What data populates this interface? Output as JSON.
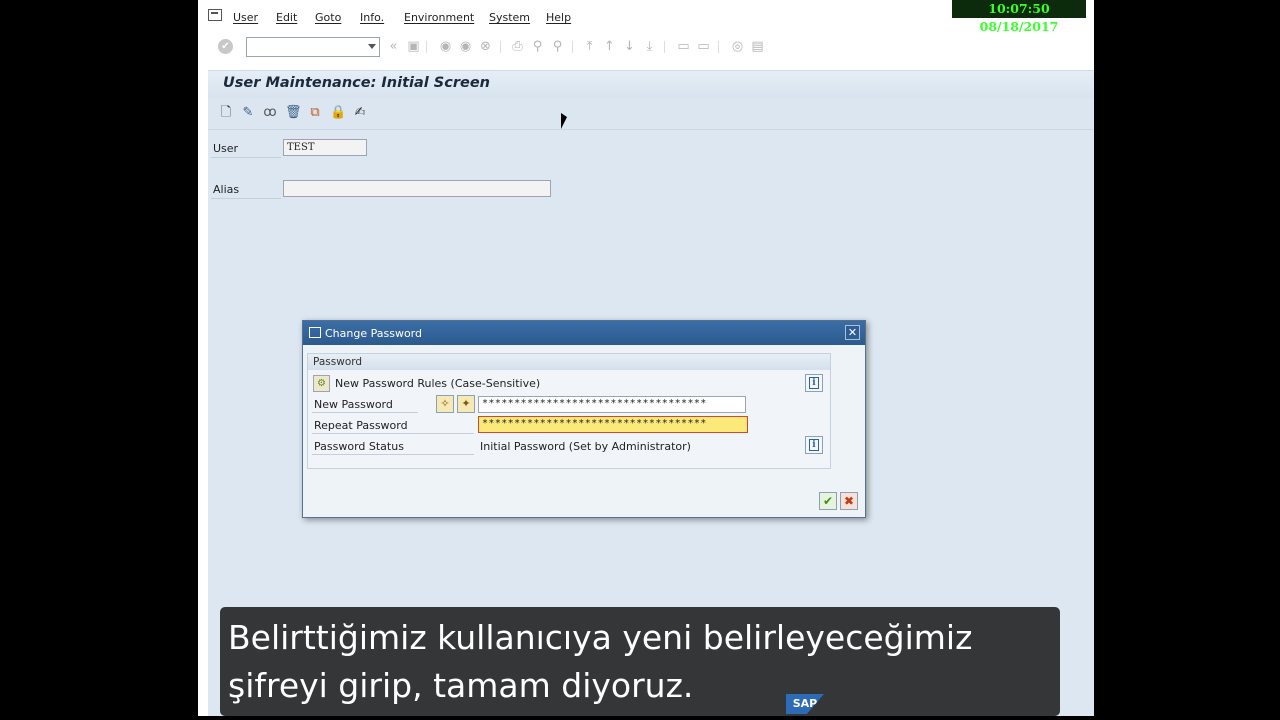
{
  "menu": {
    "items": [
      "User",
      "Edit",
      "Goto",
      "Info.",
      "Environment",
      "System",
      "Help"
    ]
  },
  "clock": {
    "time": "10:07:50",
    "date": "08/18/2017",
    "text": "10:07:50  08/18/2017"
  },
  "screen": {
    "title": "User Maintenance: Initial Screen",
    "fields": {
      "user_label": "User",
      "user_value": "TEST",
      "alias_label": "Alias",
      "alias_value": ""
    }
  },
  "dialog": {
    "title": "Change Password",
    "group_title": "Password",
    "rules_text": "New Password Rules (Case-Sensitive)",
    "new_password_label": "New Password",
    "new_password_value": "***********************************",
    "repeat_password_label": "Repeat Password",
    "repeat_password_value": "***********************************",
    "status_label": "Password Status",
    "status_value": "Initial Password (Set by Administrator)"
  },
  "subtitle": {
    "line1": "Belirttiğimiz kullanıcıya yeni belirleyeceğimiz",
    "line2": "şifreyi girip, tamam diyoruz."
  },
  "logo": {
    "text": "SAP"
  },
  "colors": {
    "dialog_title": "#2c5a8f",
    "active_field": "#fbe97a",
    "clock_text": "#39ff2a"
  }
}
